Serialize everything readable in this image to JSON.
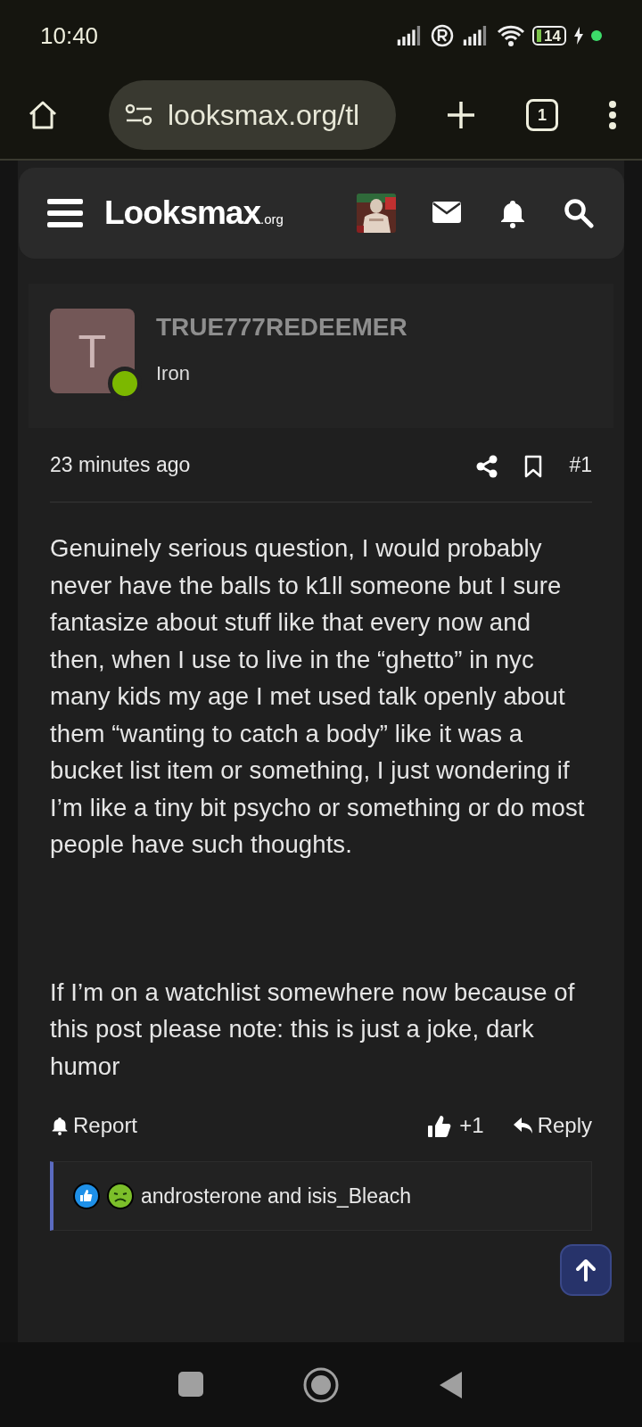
{
  "status_bar": {
    "time": "10:40",
    "battery": "14"
  },
  "browser": {
    "url": "looksmax.org/tl",
    "tab_count": "1"
  },
  "site_nav": {
    "logo": "Looksmax",
    "logo_suffix": ".org"
  },
  "post": {
    "author": {
      "name": "TRUE777REDEEMER",
      "title": "Iron",
      "avatar_letter": "T",
      "online": true
    },
    "date": "23 minutes ago",
    "number": "#1",
    "paragraphs": [
      "Genuinely serious question, I would probably never have the balls to k1ll someone but I sure fantasize about stuff like that every now and then, when I use to live in the “ghetto” in nyc many kids my age I met used talk openly about them “wanting to catch a body” like it was a bucket list item or something, I just wondering if I’m like a tiny bit psycho or something or do most people have such thoughts.",
      "If I’m on a watchlist somewhere now because of this post please note: this is just a joke, dark humor"
    ],
    "actions": {
      "report": "Report",
      "like_count": "+1",
      "reply": "Reply"
    },
    "reactions": "androsterone and isis_Bleach"
  }
}
